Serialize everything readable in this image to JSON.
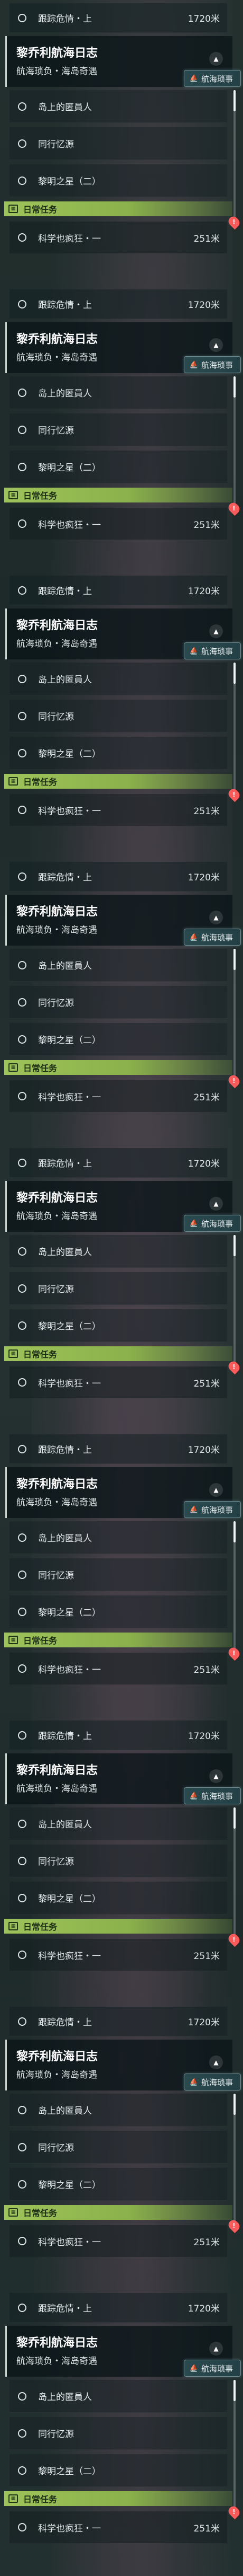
{
  "quest_block": {
    "top_row": {
      "label": "跟踪危情・上",
      "distance": "1720米"
    },
    "title": "黎乔利航海日志",
    "subtitle": "航海琐负・海岛奇遇",
    "badge": {
      "label": "航海琐事",
      "icon": "sail-icon"
    },
    "collapse_icon": "chevron-up-icon",
    "sub_items": [
      {
        "label": "岛上的匿員人"
      },
      {
        "label": "同行忆源"
      },
      {
        "label": "黎明之星（二）"
      }
    ],
    "daily": {
      "section_label": "日常任务",
      "icon": "calendar-icon",
      "row": {
        "label": "科学也疯狂・一",
        "distance": "251米"
      },
      "warn_icon": "exclamation-marker-icon"
    }
  },
  "panel_count": 9,
  "colors": {
    "daily_accent": "#9fc35a",
    "warn": "#ff5a5a",
    "badge_bg": "#2a4a4f"
  }
}
